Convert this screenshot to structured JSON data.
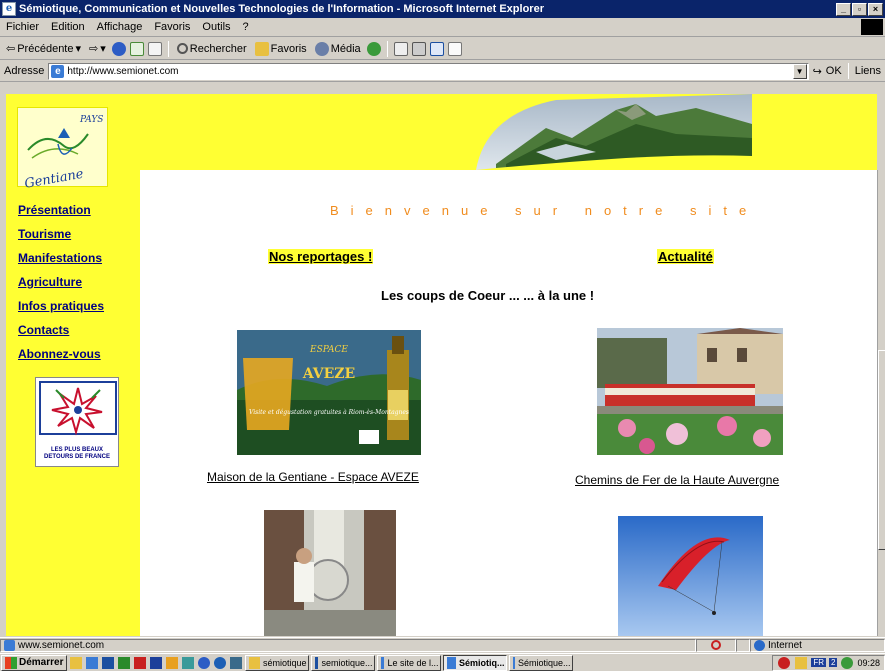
{
  "window": {
    "title": "Sémiotique, Communication et Nouvelles Technologies de l'Information - Microsoft Internet Explorer",
    "min": "_",
    "max": "▫",
    "close": "×"
  },
  "menu": [
    "Fichier",
    "Edition",
    "Affichage",
    "Favoris",
    "Outils",
    "?"
  ],
  "toolbar": {
    "back": "Précédente",
    "search": "Rechercher",
    "favorites": "Favoris",
    "media": "Média"
  },
  "address": {
    "label": "Adresse",
    "url": "http://www.semionet.com",
    "go": "OK",
    "links": "Liens"
  },
  "site": {
    "logo_top": "PAYS",
    "logo_bottom": "Gentiane",
    "nav": [
      "Présentation",
      "Tourisme",
      "Manifestations",
      "Agriculture",
      "Infos pratiques",
      "Contacts",
      "Abonnez-vous"
    ],
    "badge_text": "LES PLUS BEAUX DETOURS DE FRANCE",
    "welcome": "Bienvenue sur notre site",
    "reportages": "Nos reportages !",
    "actualite": "Actualité",
    "coups": "Les coups de Coeur ... ... à la une !",
    "caption1": "Maison de la Gentiane - Espace AVEZE",
    "caption2": "Chemins de Fer de la Haute Auvergne",
    "aveze_top": "ESPACE",
    "aveze_brand": "AVEZE",
    "aveze_text": "Visite et dégustation gratuites à Riom-ès-Montagnes"
  },
  "status": {
    "url": "www.semionet.com",
    "zone": "Internet"
  },
  "taskbar": {
    "start": "Démarrer",
    "tasks": [
      "sémiotique",
      "semiotique...",
      "Le site de l...",
      "Sémiotiq...",
      "Sémiotique..."
    ],
    "lang": "FR",
    "num": "2",
    "clock": "09:28"
  },
  "colors": {
    "page_yellow": "#ffff33",
    "nav_link": "#000080",
    "welcome": "#f08c1e",
    "titlebar": "#0a246a"
  }
}
